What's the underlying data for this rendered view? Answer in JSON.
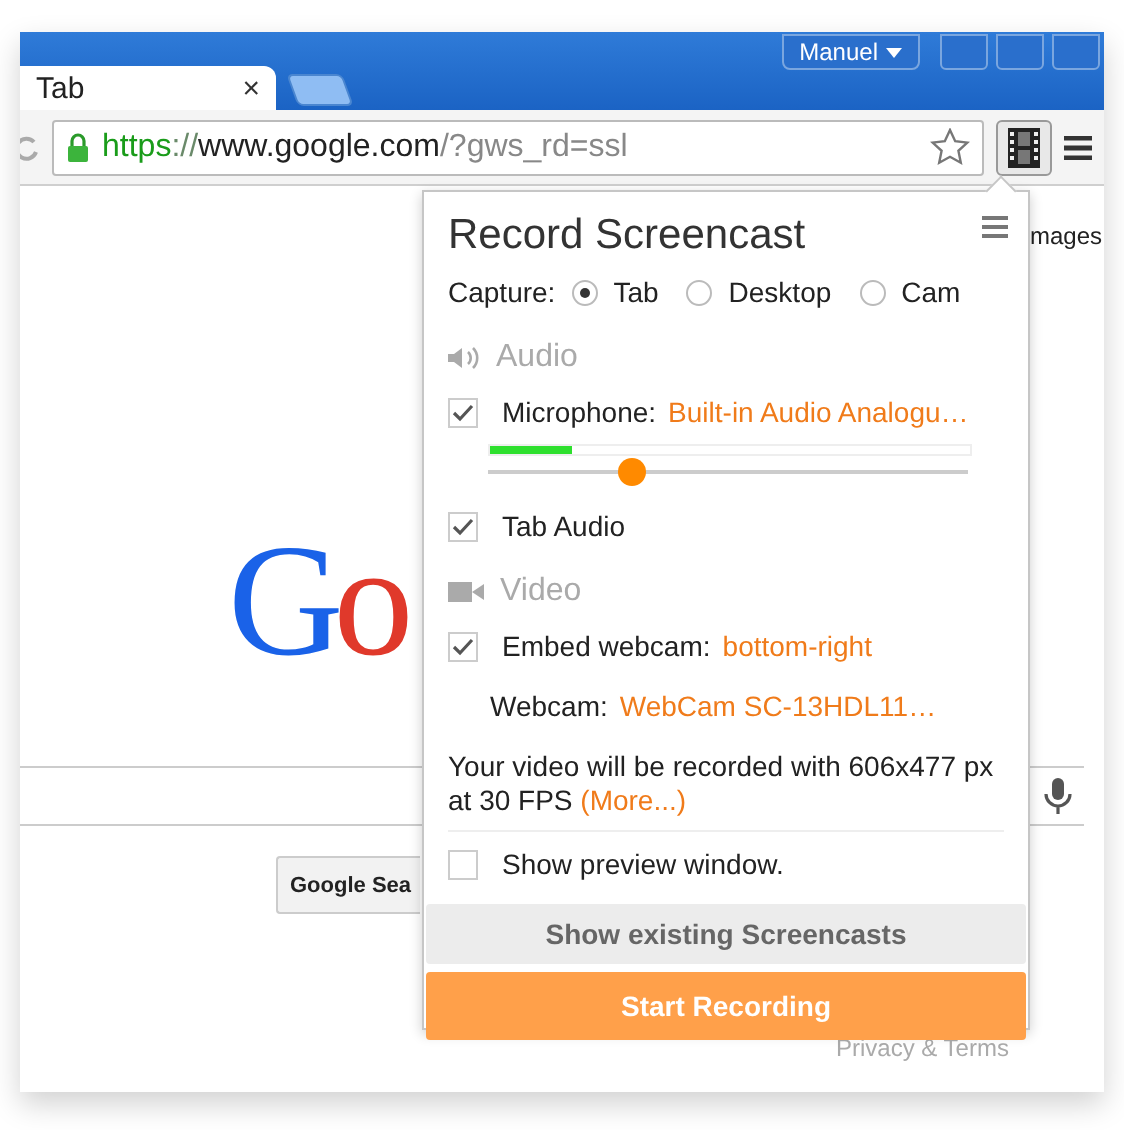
{
  "browser": {
    "profile": "Manuel",
    "tabs": [
      {
        "label": "Tab",
        "close": "×",
        "selected": true
      }
    ],
    "url_parts": [
      {
        "text": "https",
        "kind": "scheme"
      },
      {
        "text": "://",
        "kind": "sep"
      },
      {
        "text": "www.google.com",
        "kind": "host"
      },
      {
        "text": "/?gws_rd=ssl",
        "kind": "path"
      }
    ]
  },
  "page": {
    "link": "mages",
    "logo": "Go",
    "button": "Google Sea",
    "footer": "Privacy & Terms"
  },
  "popup": {
    "title": "Record Screencast",
    "capture_label": "Capture:",
    "capture_options": [
      {
        "label": "Tab",
        "selected": true
      },
      {
        "label": "Desktop",
        "selected": false
      },
      {
        "label": "Cam",
        "selected": false
      }
    ],
    "audio": {
      "heading": "Audio",
      "microphone": {
        "label": "Microphone:",
        "value": "Built-in Audio Analogu…",
        "checked": true
      },
      "meter": {
        "level": 0.17
      },
      "slider": {
        "level": 0.3
      },
      "tab_audio": {
        "label": "Tab Audio",
        "checked": true
      }
    },
    "video": {
      "heading": "Video",
      "embed": {
        "label": "Embed webcam:",
        "value": "bottom-right",
        "checked": true
      },
      "webcam": {
        "label": "Webcam:",
        "value": "WebCam SC-13HDL11…"
      },
      "info": "Your video will be recorded with 606x477 px at 30 FPS",
      "more_link": "(More...)"
    },
    "preview": {
      "label": "Show preview window.",
      "checked": false
    },
    "buttons": [
      {
        "label": "Show existing Screencasts",
        "kind": "secondary"
      },
      {
        "label": "Start Recording",
        "kind": "primary"
      }
    ]
  }
}
